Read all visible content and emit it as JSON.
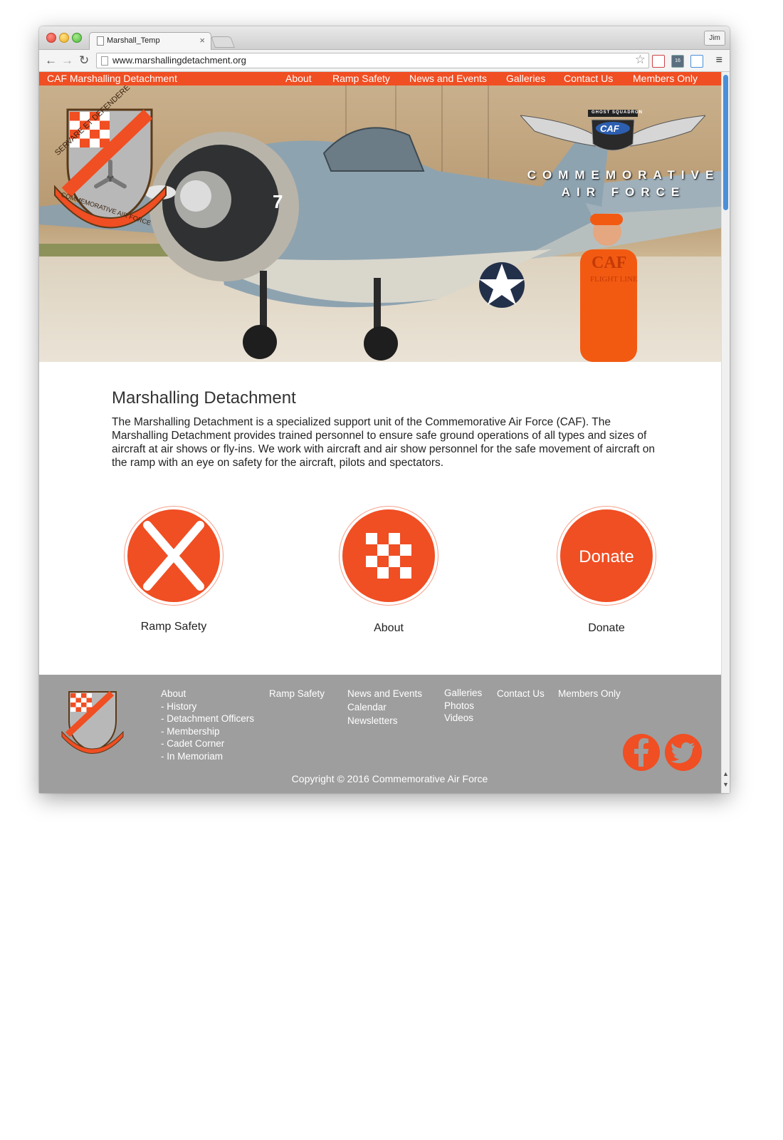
{
  "browser": {
    "tab_title": "Marshall_Temp",
    "tab_close": "×",
    "user_button": "Jim",
    "url": "www.marshallingdetachment.org",
    "back_glyph": "←",
    "forward_glyph": "→",
    "reload_glyph": "↻",
    "star_glyph": "☆",
    "menu_glyph": "≡",
    "extension_badge": "16"
  },
  "nav": {
    "brand": "CAF Marshalling Detachment",
    "links": [
      "About",
      "Ramp Safety",
      "News and Events",
      "Galleries",
      "Contact Us",
      "Members Only"
    ]
  },
  "hero": {
    "crest_motto": "SERVARE ET DEFENDERE",
    "crest_org": "COMMEMORATIVE AIR FORCE",
    "logo_squadron": "GHOST SQUADRON",
    "logo_caf": "CAF",
    "logo_line1": "COMMEMORATIVE",
    "logo_line2": "AIR FORCE",
    "aircraft_number": "7",
    "suit_caf": "CAF",
    "suit_text": "FLIGHT LINE"
  },
  "main": {
    "title": "Marshalling Detachment",
    "body": "The Marshalling Detachment is a specialized support unit of the Commemorative Air Force (CAF). The Marshalling Detachment provides trained personnel to ensure safe ground operations of all types and sizes of aircraft at air shows or fly-ins. We work with aircraft and air show personnel for the safe movement of aircraft on the ramp with an eye on safety for the aircraft, pilots and spectators.",
    "features": [
      {
        "label": "Ramp Safety",
        "icon": "crossed-wands-icon"
      },
      {
        "label": "About",
        "icon": "checkerboard-icon"
      },
      {
        "label": "Donate",
        "icon": "donate-button",
        "button_text": "Donate"
      }
    ]
  },
  "footer": {
    "about": [
      "About",
      "- History",
      "- Detachment Officers",
      "- Membership",
      "- Cadet Corner",
      "- In Memoriam"
    ],
    "ramp_safety": "Ramp Safety",
    "news": [
      "News and Events",
      "Calendar",
      "Newsletters"
    ],
    "galleries": [
      "Galleries",
      "Photos",
      "Videos"
    ],
    "contact": "Contact Us",
    "members": "Members Only",
    "copyright": "Copyright © 2016 Commemorative Air Force",
    "social": [
      "facebook-icon",
      "twitter-icon"
    ]
  },
  "colors": {
    "accent": "#f04e23",
    "footer_bg": "#9e9e9e"
  }
}
